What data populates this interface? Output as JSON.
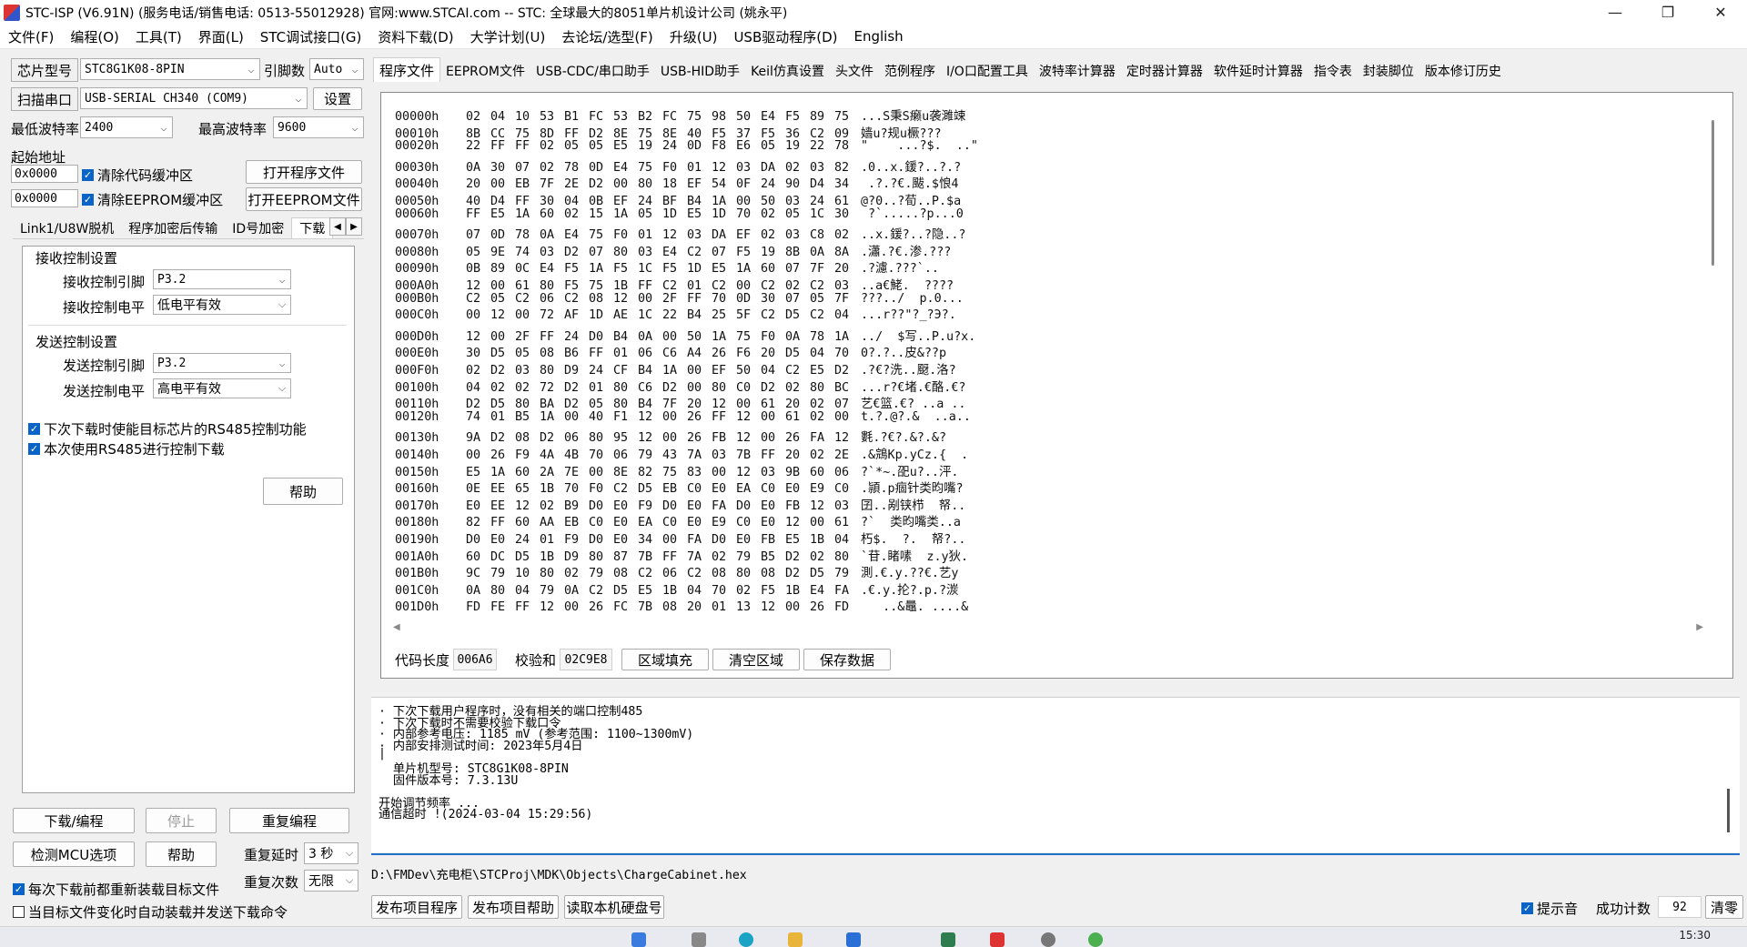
{
  "window": {
    "title": "STC-ISP (V6.91N) (服务电话/销售电话: 0513-55012928) 官网:www.STCAI.com  -- STC: 全球最大的8051单片机设计公司 (姚永平)",
    "minimize": "—",
    "maximize": "❐",
    "close": "✕"
  },
  "menu": [
    "文件(F)",
    "编程(O)",
    "工具(T)",
    "界面(L)",
    "STC调试接口(G)",
    "资料下载(D)",
    "大学计划(U)",
    "去论坛/选型(F)",
    "升级(U)",
    "USB驱动程序(D)",
    "English"
  ],
  "left": {
    "chip_label": "芯片型号",
    "chip_value": "STC8G1K08-8PIN",
    "pins_label": "引脚数",
    "pins_value": "Auto",
    "scan_label": "扫描串口",
    "port_value": "USB-SERIAL CH340 (COM9)",
    "settings_btn": "设置",
    "min_baud_label": "最低波特率",
    "min_baud_value": "2400",
    "max_baud_label": "最高波特率",
    "max_baud_value": "9600",
    "start_addr_label": "起始地址",
    "code_addr": "0x0000",
    "clear_code_cb": "清除代码缓冲区",
    "clear_code_checked": true,
    "open_prog_btn": "打开程序文件",
    "eeprom_addr": "0x0000",
    "clear_eeprom_cb": "清除EEPROM缓冲区",
    "clear_eeprom_checked": true,
    "open_eeprom_btn": "打开EEPROM文件",
    "subtabs": [
      "Link1/U8W脱机",
      "程序加密后传输",
      "ID号加密",
      "下载"
    ],
    "recv_group": "接收控制设置",
    "recv_pin_label": "接收控制引脚",
    "recv_pin_value": "P3.2",
    "recv_level_label": "接收控制电平",
    "recv_level_value": "低电平有效",
    "send_group": "发送控制设置",
    "send_pin_label": "发送控制引脚",
    "send_pin_value": "P3.2",
    "send_level_label": "发送控制电平",
    "send_level_value": "高电平有效",
    "rs485_enable_cb": "下次下载时使能目标芯片的RS485控制功能",
    "rs485_use_cb": "本次使用RS485进行控制下载",
    "help_btn": "帮助",
    "download_btn": "下载/编程",
    "stop_btn": "停止",
    "reprogram_btn": "重复编程",
    "check_mcu_btn": "检测MCU选项",
    "help2_btn": "帮助",
    "repeat_delay_label": "重复延时",
    "repeat_delay_value": "3 秒",
    "repeat_count_label": "重复次数",
    "repeat_count_value": "无限",
    "reload_cb": "每次下载前都重新装载目标文件",
    "reload_checked": true,
    "autoload_cb": "当目标文件变化时自动装载并发送下载命令",
    "autoload_checked": false
  },
  "tabs": [
    "程序文件",
    "EEPROM文件",
    "USB-CDC/串口助手",
    "USB-HID助手",
    "Keil仿真设置",
    "头文件",
    "范例程序",
    "I/O口配置工具",
    "波特率计算器",
    "定时器计算器",
    "软件延时计算器",
    "指令表",
    "封装脚位",
    "版本修订历史"
  ],
  "hex": {
    "rows": [
      {
        "addr": "00000h",
        "bytes": [
          "02",
          "04",
          "10",
          "53",
          "B1",
          "FC",
          "53",
          "B2",
          "FC",
          "75",
          "98",
          "50",
          "E4",
          "F5",
          "89",
          "75"
        ],
        "ascii": "...S秉S癞u袭濉竦"
      },
      {
        "addr": "00010h",
        "bytes": [
          "8B",
          "CC",
          "75",
          "8D",
          "FF",
          "D2",
          "8E",
          "75",
          "8E",
          "40",
          "F5",
          "37",
          "F5",
          "36",
          "C2",
          "09"
        ],
        "ascii": "嫱u?规u橛???"
      },
      {
        "addr": "00020h",
        "bytes": [
          "22",
          "FF",
          "FF",
          "02",
          "05",
          "05",
          "E5",
          "19",
          "24",
          "0D",
          "F8",
          "E6",
          "05",
          "19",
          "22",
          "78"
        ],
        "ascii": "\"    ...?$.  ..\""
      },
      {
        "addr": "00030h",
        "bytes": [
          "0A",
          "30",
          "07",
          "02",
          "78",
          "0D",
          "E4",
          "75",
          "F0",
          "01",
          "12",
          "03",
          "DA",
          "02",
          "03",
          "82"
        ],
        "ascii": ".0..x.鍰?..?.?"
      },
      {
        "addr": "00040h",
        "bytes": [
          "20",
          "00",
          "EB",
          "7F",
          "2E",
          "D2",
          "00",
          "80",
          "18",
          "EF",
          "54",
          "0F",
          "24",
          "90",
          "D4",
          "34"
        ],
        "ascii": " .?.?€.颰.$悢4"
      },
      {
        "addr": "00050h",
        "bytes": [
          "40",
          "D4",
          "FF",
          "30",
          "04",
          "0B",
          "EF",
          "24",
          "BF",
          "B4",
          "1A",
          "00",
          "50",
          "03",
          "24",
          "61"
        ],
        "ascii": "@?0..?荀..P.$a"
      },
      {
        "addr": "00060h",
        "bytes": [
          "FF",
          "E5",
          "1A",
          "60",
          "02",
          "15",
          "1A",
          "05",
          "1D",
          "E5",
          "1D",
          "70",
          "02",
          "05",
          "1C",
          "30"
        ],
        "ascii": " ?`.....?p...0"
      },
      {
        "addr": "00070h",
        "bytes": [
          "07",
          "0D",
          "78",
          "0A",
          "E4",
          "75",
          "F0",
          "01",
          "12",
          "03",
          "DA",
          "EF",
          "02",
          "03",
          "C8",
          "02"
        ],
        "ascii": "..x.鍰?..?隐..?"
      },
      {
        "addr": "00080h",
        "bytes": [
          "05",
          "9E",
          "74",
          "03",
          "D2",
          "07",
          "80",
          "03",
          "E4",
          "C2",
          "07",
          "F5",
          "19",
          "8B",
          "0A",
          "8A"
        ],
        "ascii": ".瀟.?€.渗.???"
      },
      {
        "addr": "00090h",
        "bytes": [
          "0B",
          "89",
          "0C",
          "E4",
          "F5",
          "1A",
          "F5",
          "1C",
          "F5",
          "1D",
          "E5",
          "1A",
          "60",
          "07",
          "7F",
          "20"
        ],
        "ascii": ".?濾.???`.. "
      },
      {
        "addr": "000A0h",
        "bytes": [
          "12",
          "00",
          "61",
          "80",
          "F5",
          "75",
          "1B",
          "FF",
          "C2",
          "01",
          "C2",
          "00",
          "C2",
          "02",
          "C2",
          "03"
        ],
        "ascii": "..a€鮱.  ????"
      },
      {
        "addr": "000B0h",
        "bytes": [
          "C2",
          "05",
          "C2",
          "06",
          "C2",
          "08",
          "12",
          "00",
          "2F",
          "FF",
          "70",
          "0D",
          "30",
          "07",
          "05",
          "7F"
        ],
        "ascii": "???../  p.0..."
      },
      {
        "addr": "000C0h",
        "bytes": [
          "00",
          "12",
          "00",
          "72",
          "AF",
          "1D",
          "AE",
          "1C",
          "22",
          "B4",
          "25",
          "5F",
          "C2",
          "D5",
          "C2",
          "04"
        ],
        "ascii": "...r??\"?_?Э?."
      },
      {
        "addr": "000D0h",
        "bytes": [
          "12",
          "00",
          "2F",
          "FF",
          "24",
          "D0",
          "B4",
          "0A",
          "00",
          "50",
          "1A",
          "75",
          "F0",
          "0A",
          "78",
          "1A"
        ],
        "ascii": "../  $写..P.u?x."
      },
      {
        "addr": "000E0h",
        "bytes": [
          "30",
          "D5",
          "05",
          "08",
          "B6",
          "FF",
          "01",
          "06",
          "C6",
          "A4",
          "26",
          "F6",
          "20",
          "D5",
          "04",
          "70"
        ],
        "ascii": "0?.?..皮&??p"
      },
      {
        "addr": "000F0h",
        "bytes": [
          "02",
          "D2",
          "03",
          "80",
          "D9",
          "24",
          "CF",
          "B4",
          "1A",
          "00",
          "EF",
          "50",
          "04",
          "C2",
          "E5",
          "D2"
        ],
        "ascii": ".?€?洗..颬.洛?"
      },
      {
        "addr": "00100h",
        "bytes": [
          "04",
          "02",
          "02",
          "72",
          "D2",
          "01",
          "80",
          "C6",
          "D2",
          "00",
          "80",
          "C0",
          "D2",
          "02",
          "80",
          "BC"
        ],
        "ascii": "...r?€堵.€酪.€?"
      },
      {
        "addr": "00110h",
        "bytes": [
          "D2",
          "D5",
          "80",
          "BA",
          "D2",
          "05",
          "80",
          "B4",
          "7F",
          "20",
          "12",
          "00",
          "61",
          "20",
          "02",
          "07"
        ],
        "ascii": "艺€篮.€? ..a .."
      },
      {
        "addr": "00120h",
        "bytes": [
          "74",
          "01",
          "B5",
          "1A",
          "00",
          "40",
          "F1",
          "12",
          "00",
          "26",
          "FF",
          "12",
          "00",
          "61",
          "02",
          "00"
        ],
        "ascii": "t.?.@?.&  ..a.."
      },
      {
        "addr": "00130h",
        "bytes": [
          "9A",
          "D2",
          "08",
          "D2",
          "06",
          "80",
          "95",
          "12",
          "00",
          "26",
          "FB",
          "12",
          "00",
          "26",
          "FA",
          "12"
        ],
        "ascii": "氀.?€?.&?.&?"
      },
      {
        "addr": "00140h",
        "bytes": [
          "00",
          "26",
          "F9",
          "4A",
          "4B",
          "70",
          "06",
          "79",
          "43",
          "7A",
          "03",
          "7B",
          "FF",
          "20",
          "02",
          "2E"
        ],
        "ascii": ".&鵍Kp.yCz.{  ."
      },
      {
        "addr": "00150h",
        "bytes": [
          "E5",
          "1A",
          "60",
          "2A",
          "7E",
          "00",
          "8E",
          "82",
          "75",
          "83",
          "00",
          "12",
          "03",
          "9B",
          "60",
          "06"
        ],
        "ascii": "?`*~.巶u?..泙."
      },
      {
        "addr": "00160h",
        "bytes": [
          "0E",
          "EE",
          "65",
          "1B",
          "70",
          "F0",
          "C2",
          "D5",
          "EB",
          "C0",
          "E0",
          "EA",
          "C0",
          "E0",
          "E9",
          "C0"
        ],
        "ascii": ".頴.p痼针类昀嘴?"
      },
      {
        "addr": "00170h",
        "bytes": [
          "E0",
          "EE",
          "12",
          "02",
          "B9",
          "D0",
          "E0",
          "F9",
          "D0",
          "E0",
          "FA",
          "D0",
          "E0",
          "FB",
          "12",
          "03"
        ],
        "ascii": "囝..剐铗栉  帑.."
      },
      {
        "addr": "00180h",
        "bytes": [
          "82",
          "FF",
          "60",
          "AA",
          "EB",
          "C0",
          "E0",
          "EA",
          "C0",
          "E0",
          "E9",
          "C0",
          "E0",
          "12",
          "00",
          "61"
        ],
        "ascii": "?`  类昀嘴类..a"
      },
      {
        "addr": "00190h",
        "bytes": [
          "D0",
          "E0",
          "24",
          "01",
          "F9",
          "D0",
          "E0",
          "34",
          "00",
          "FA",
          "D0",
          "E0",
          "FB",
          "E5",
          "1B",
          "04"
        ],
        "ascii": "朽$.  ?.  帑?.."
      },
      {
        "addr": "001A0h",
        "bytes": [
          "60",
          "DC",
          "D5",
          "1B",
          "D9",
          "80",
          "87",
          "7B",
          "FF",
          "7A",
          "02",
          "79",
          "B5",
          "D2",
          "02",
          "80"
        ],
        "ascii": "`苷.睹嗉  z.y狄."
      },
      {
        "addr": "001B0h",
        "bytes": [
          "9C",
          "79",
          "10",
          "80",
          "02",
          "79",
          "08",
          "C2",
          "06",
          "C2",
          "08",
          "80",
          "08",
          "D2",
          "D5",
          "79"
        ],
        "ascii": "測.€.y.??€.艺y"
      },
      {
        "addr": "001C0h",
        "bytes": [
          "0A",
          "80",
          "04",
          "79",
          "0A",
          "C2",
          "D5",
          "E5",
          "1B",
          "04",
          "70",
          "02",
          "F5",
          "1B",
          "E4",
          "FA"
        ],
        "ascii": ".€.y.抡?.p.?湠"
      },
      {
        "addr": "001D0h",
        "bytes": [
          "FD",
          "FE",
          "FF",
          "12",
          "00",
          "26",
          "FC",
          "7B",
          "08",
          "20",
          "01",
          "13",
          "12",
          "00",
          "26",
          "FD"
        ],
        "ascii": "   ..&鼂. ....&"
      }
    ],
    "code_len_label": "代码长度",
    "code_len_value": "006A6",
    "checksum_label": "校验和",
    "checksum_value": "02C9E8",
    "fill_btn": "区域填充",
    "clear_btn": "清空区域",
    "save_btn": "保存数据"
  },
  "log": [
    "· 下次下载用户程序时，没有相关的端口控制485",
    "· 下次下载时不需要校验下载口令",
    "· 内部参考电压: 1185 mV (参考范围: 1100~1300mV)",
    "· 内部安排测试时间: 2023年5月4日",
    "|",
    "  单片机型号: STC8G1K08-8PIN",
    "  固件版本号: 7.3.13U",
    "",
    "开始调节频率 ...",
    "通信超时 !(2024-03-04 15:29:56)"
  ],
  "path": "D:\\FMDev\\充电柜\\STCProj\\MDK\\Objects\\ChargeCabinet.hex",
  "bottom": {
    "publish_btn": "发布项目程序",
    "publish_help_btn": "发布项目帮助",
    "read_disk_btn": "读取本机硬盘号",
    "sound_cb": "提示音",
    "sound_checked": true,
    "success_label": "成功计数",
    "success_value": "92",
    "clear_btn": "清零"
  },
  "taskbar": {
    "clock": "15:30"
  }
}
